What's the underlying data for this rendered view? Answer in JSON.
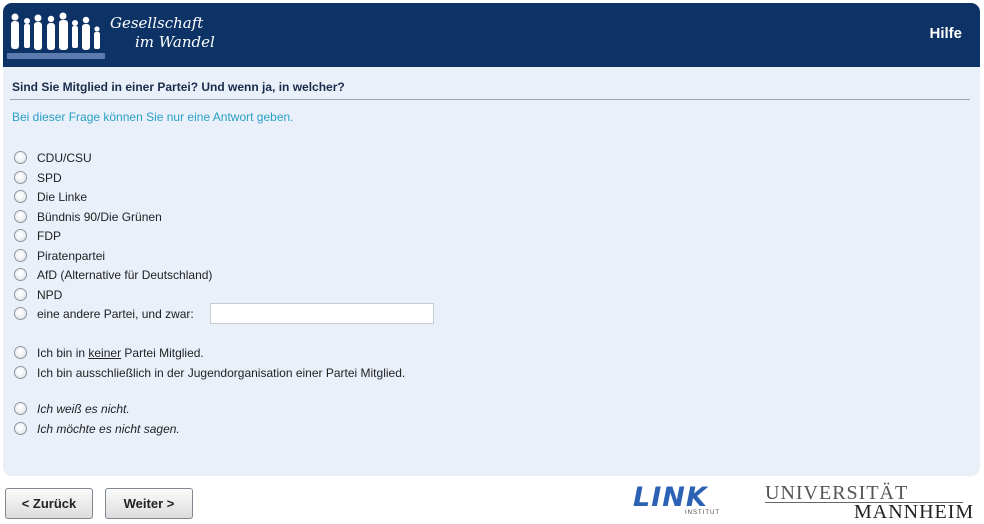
{
  "header": {
    "brand_line1": "Gesellschaft",
    "brand_line2": "im Wandel",
    "help_label": "Hilfe",
    "colors": {
      "header_bg": "#0d3266",
      "panel_bg": "#e9f0fa"
    }
  },
  "question": {
    "title": "Sind Sie Mitglied in einer Partei? Und wenn ja, in welcher?",
    "instruction": "Bei dieser Frage können Sie nur eine Antwort geben."
  },
  "options": [
    {
      "label": "CDU/CSU"
    },
    {
      "label": "SPD"
    },
    {
      "label": "Die Linke"
    },
    {
      "label": "Bündnis 90/Die Grünen"
    },
    {
      "label": "FDP"
    },
    {
      "label": "Piratenpartei"
    },
    {
      "label": "AfD (Alternative für Deutschland)"
    },
    {
      "label": "NPD"
    },
    {
      "label": "eine andere Partei, und zwar:",
      "other_value": ""
    },
    {
      "label_pre": "Ich bin in ",
      "label_underlined": "keiner",
      "label_post": " Partei Mitglied."
    },
    {
      "label": "Ich bin ausschließlich in der Jugendorganisation einer Partei Mitglied."
    },
    {
      "label": "Ich weiß es nicht."
    },
    {
      "label": "Ich möchte es nicht sagen."
    }
  ],
  "navigation": {
    "back_label": "< Zurück",
    "next_label": "Weiter >"
  },
  "logos": {
    "link_text": "LINK",
    "link_subtext": "INSTITUT",
    "uni_line1": "UNIVERSITÄT",
    "uni_line2": "MANNHEIM"
  }
}
